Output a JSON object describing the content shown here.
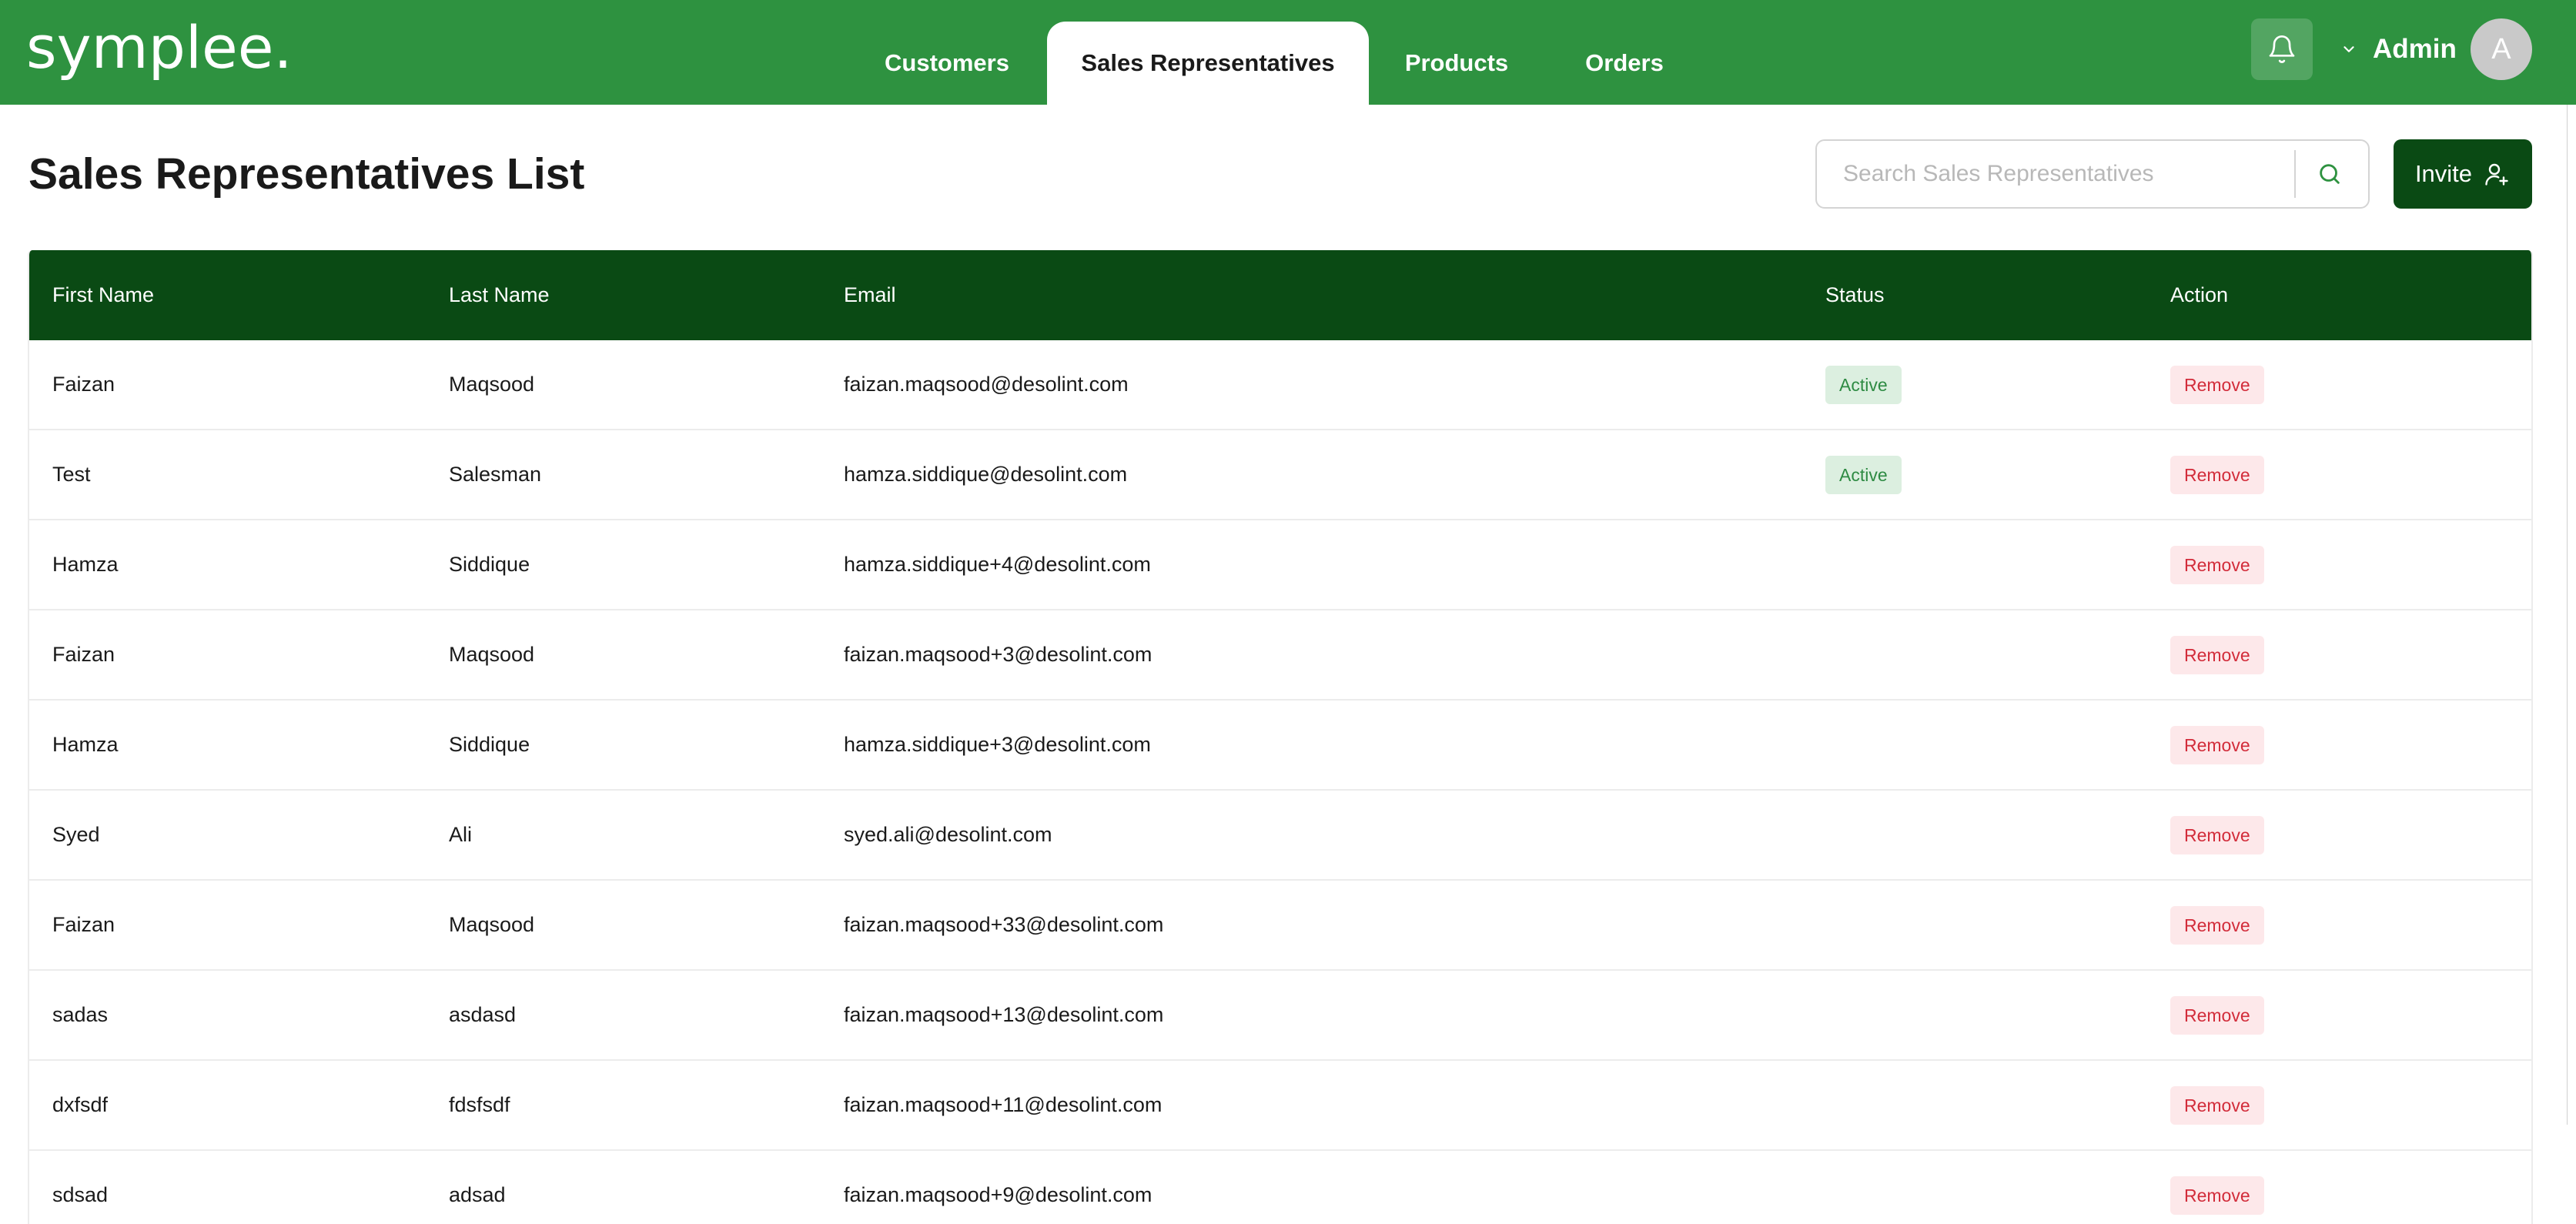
{
  "app": {
    "logo": "symplee."
  },
  "nav": {
    "tabs": [
      {
        "label": "Customers"
      },
      {
        "label": "Sales Representatives"
      },
      {
        "label": "Products"
      },
      {
        "label": "Orders"
      }
    ],
    "active_tab": "Sales Representatives"
  },
  "user": {
    "name": "Admin",
    "avatar_initial": "A"
  },
  "page": {
    "title": "Sales Representatives List"
  },
  "search": {
    "placeholder": "Search Sales Representatives",
    "value": ""
  },
  "invite_button": {
    "label": "Invite"
  },
  "table": {
    "columns": [
      "First Name",
      "Last Name",
      "Email",
      "Status",
      "Action"
    ],
    "rows": [
      {
        "first": "Faizan",
        "last": "Maqsood",
        "email": "faizan.maqsood@desolint.com",
        "status": "Active",
        "action": "Remove"
      },
      {
        "first": "Test",
        "last": "Salesman",
        "email": "hamza.siddique@desolint.com",
        "status": "Active",
        "action": "Remove"
      },
      {
        "first": "Hamza",
        "last": "Siddique",
        "email": "hamza.siddique+4@desolint.com",
        "status": "",
        "action": "Remove"
      },
      {
        "first": "Faizan",
        "last": "Maqsood",
        "email": "faizan.maqsood+3@desolint.com",
        "status": "",
        "action": "Remove"
      },
      {
        "first": "Hamza",
        "last": "Siddique",
        "email": "hamza.siddique+3@desolint.com",
        "status": "",
        "action": "Remove"
      },
      {
        "first": "Syed",
        "last": "Ali",
        "email": "syed.ali@desolint.com",
        "status": "",
        "action": "Remove"
      },
      {
        "first": "Faizan",
        "last": "Maqsood",
        "email": "faizan.maqsood+33@desolint.com",
        "status": "",
        "action": "Remove"
      },
      {
        "first": "sadas",
        "last": "asdasd",
        "email": "faizan.maqsood+13@desolint.com",
        "status": "",
        "action": "Remove"
      },
      {
        "first": "dxfsdf",
        "last": "fdsfsdf",
        "email": "faizan.maqsood+11@desolint.com",
        "status": "",
        "action": "Remove"
      },
      {
        "first": "sdsad",
        "last": "adsad",
        "email": "faizan.maqsood+9@desolint.com",
        "status": "",
        "action": "Remove"
      }
    ]
  },
  "icons": {
    "notification": "bell-icon",
    "dropdown": "chevron-down-icon",
    "search": "search-icon",
    "invite": "add-user-icon"
  },
  "colors": {
    "brand_green": "#2e9240",
    "dark_green": "#0a4a14",
    "active_badge_bg": "#dcefe0",
    "active_badge_text": "#2e8b43",
    "remove_bg": "#fde8ea",
    "remove_text": "#d22c3a"
  }
}
